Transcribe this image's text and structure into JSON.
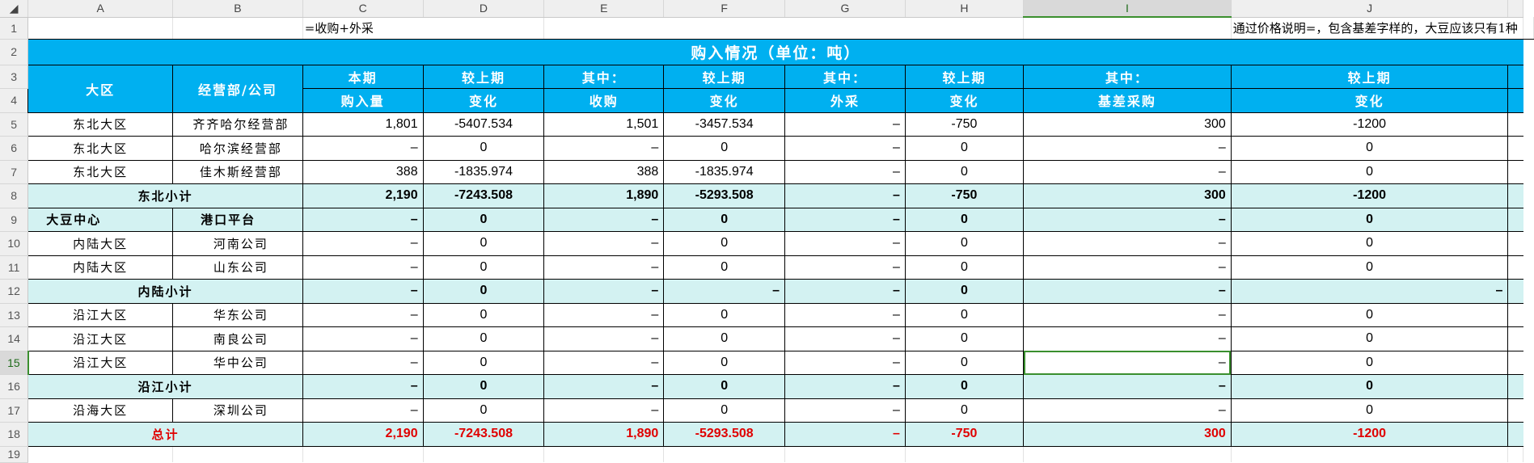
{
  "columns": [
    "A",
    "B",
    "C",
    "D",
    "E",
    "F",
    "G",
    "H",
    "I",
    "J"
  ],
  "selected_column": "I",
  "selected_row": 15,
  "row1": {
    "c_note": "=收购+外采",
    "i_note": "通过价格说明=，包含基差字样的，大豆应该只有1种"
  },
  "title": "购入情况（单位：吨）",
  "headers": {
    "region": "大区",
    "dept": "经营部/公司",
    "top": [
      "本期",
      "较上期",
      "其中：",
      "较上期",
      "其中：",
      "较上期",
      "其中：",
      "较上期"
    ],
    "bottom": [
      "购入量",
      "变化",
      "收购",
      "变化",
      "外采",
      "变化",
      "基差采购",
      "变化"
    ]
  },
  "rows": [
    {
      "n": 5,
      "type": "data",
      "a": "东北大区",
      "b": "齐齐哈尔经营部",
      "v": [
        "1,801",
        "-5407.534",
        "1,501",
        "-3457.534",
        "–",
        "-750",
        "300",
        "-1200"
      ]
    },
    {
      "n": 6,
      "type": "data",
      "a": "东北大区",
      "b": "哈尔滨经营部",
      "v": [
        "–",
        "0",
        "–",
        "0",
        "–",
        "0",
        "–",
        "0"
      ]
    },
    {
      "n": 7,
      "type": "data",
      "a": "东北大区",
      "b": "佳木斯经营部",
      "v": [
        "388",
        "-1835.974",
        "388",
        "-1835.974",
        "–",
        "0",
        "–",
        "0"
      ]
    },
    {
      "n": 8,
      "type": "sub",
      "ab": "东北小计",
      "v": [
        "2,190",
        "-7243.508",
        "1,890",
        "-5293.508",
        "–",
        "-750",
        "300",
        "-1200"
      ]
    },
    {
      "n": 9,
      "type": "sub2",
      "a": "大豆中心",
      "b": "港口平台",
      "v": [
        "–",
        "0",
        "–",
        "0",
        "–",
        "0",
        "–",
        "0"
      ]
    },
    {
      "n": 10,
      "type": "data",
      "a": "内陆大区",
      "b": "河南公司",
      "v": [
        "–",
        "0",
        "–",
        "0",
        "–",
        "0",
        "–",
        "0"
      ]
    },
    {
      "n": 11,
      "type": "data",
      "a": "内陆大区",
      "b": "山东公司",
      "v": [
        "–",
        "0",
        "–",
        "0",
        "–",
        "0",
        "–",
        "0"
      ]
    },
    {
      "n": 12,
      "type": "sub",
      "ab": "内陆小计",
      "v": [
        "–",
        "0",
        "–",
        "–",
        "–",
        "0",
        "–",
        "–"
      ],
      "right_f": true
    },
    {
      "n": 13,
      "type": "data",
      "a": "沿江大区",
      "b": "华东公司",
      "v": [
        "–",
        "0",
        "–",
        "0",
        "–",
        "0",
        "–",
        "0"
      ]
    },
    {
      "n": 14,
      "type": "data",
      "a": "沿江大区",
      "b": "南良公司",
      "v": [
        "–",
        "0",
        "–",
        "0",
        "–",
        "0",
        "–",
        "0"
      ]
    },
    {
      "n": 15,
      "type": "data",
      "a": "沿江大区",
      "b": "华中公司",
      "v": [
        "–",
        "0",
        "–",
        "0",
        "–",
        "0",
        "–",
        "0"
      ]
    },
    {
      "n": 16,
      "type": "sub",
      "ab": "沿江小计",
      "v": [
        "–",
        "0",
        "–",
        "0",
        "–",
        "0",
        "–",
        "0"
      ]
    },
    {
      "n": 17,
      "type": "data",
      "a": "沿海大区",
      "b": "深圳公司",
      "v": [
        "–",
        "0",
        "–",
        "0",
        "–",
        "0",
        "–",
        "0"
      ]
    },
    {
      "n": 18,
      "type": "tot",
      "ab": "总计",
      "v": [
        "2,190",
        "-7243.508",
        "1,890",
        "-5293.508",
        "–",
        "-750",
        "300",
        "-1200"
      ]
    }
  ]
}
